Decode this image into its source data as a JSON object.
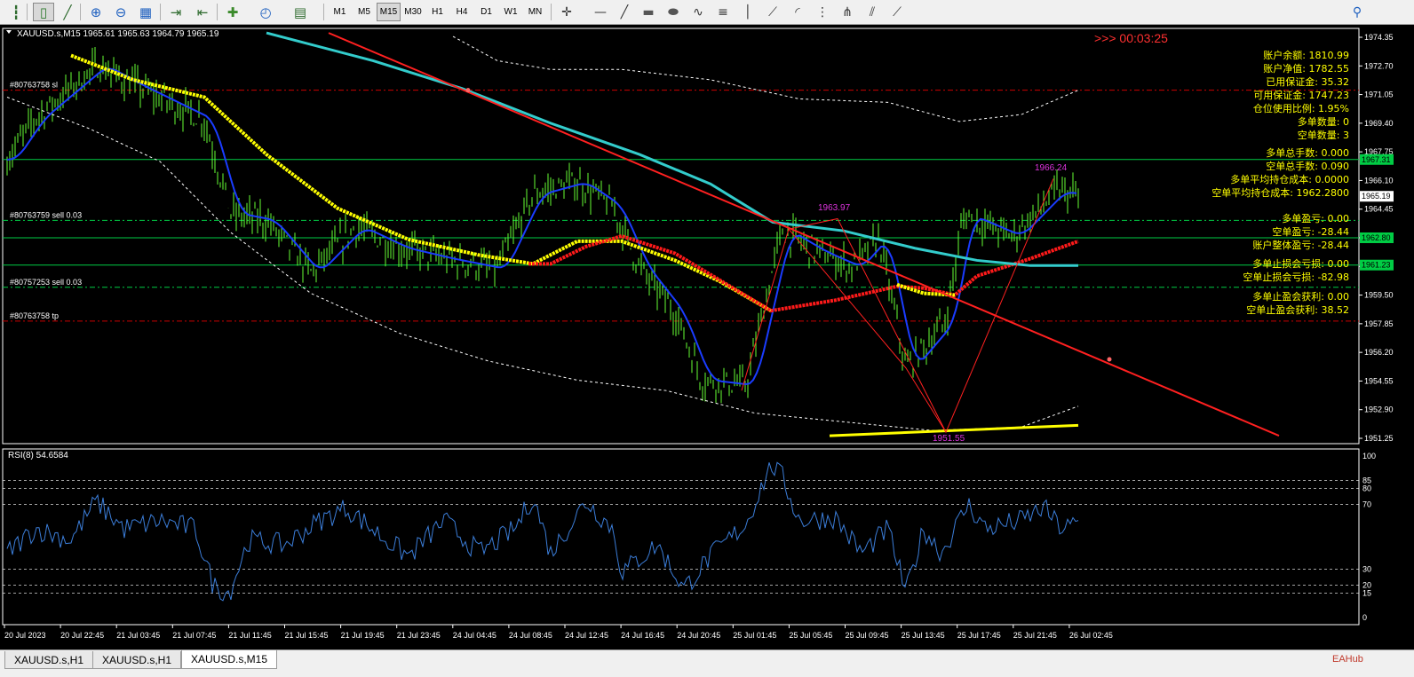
{
  "toolbar": {
    "buttons": [
      "bar-chart-icon",
      "candlestick-icon",
      "line-chart-icon",
      "zoom-in-icon",
      "zoom-out-icon",
      "tile-windows-icon",
      "auto-scroll-icon",
      "chart-shift-icon",
      "indicators-icon",
      "clock-icon",
      "templates-icon"
    ],
    "timeframes": [
      "M1",
      "M5",
      "M15",
      "M30",
      "H1",
      "H4",
      "D1",
      "W1",
      "MN"
    ],
    "active_timeframe": "M15",
    "draw_tools": [
      "crosshair-icon",
      "horizontal-line-icon",
      "trendline-icon",
      "rectangle-icon",
      "ellipse-icon",
      "elliott-icon",
      "fibonacci-icon",
      "vertical-line-icon",
      "fibo-fan-icon",
      "fibo-arc-icon",
      "fibo-time-icon",
      "andrews-icon",
      "channel-icon",
      "gann-icon",
      "search-icon"
    ]
  },
  "chart": {
    "header": "XAUUSD.s,M15  1965.61 1965.63 1964.79 1965.19",
    "timer": ">>> 00:03:25",
    "price_axis": [
      "1974.35",
      "1972.70",
      "1971.05",
      "1969.40",
      "1967.75",
      "1966.10",
      "1964.45",
      "1962.80",
      "1961.15",
      "1959.50",
      "1957.85",
      "1956.20",
      "1954.55",
      "1952.90",
      "1951.25"
    ],
    "price_tags": [
      {
        "label": "1967.31",
        "color": "#00cc44"
      },
      {
        "label": "1965.19",
        "color": "#ffffff"
      },
      {
        "label": "1962.80",
        "color": "#00cc44"
      },
      {
        "label": "1961.23",
        "color": "#00cc44"
      }
    ],
    "time_axis": [
      "20 Jul 2023",
      "20 Jul 22:45",
      "21 Jul 03:45",
      "21 Jul 07:45",
      "21 Jul 11:45",
      "21 Jul 15:45",
      "21 Jul 19:45",
      "21 Jul 23:45",
      "24 Jul 04:45",
      "24 Jul 08:45",
      "24 Jul 12:45",
      "24 Jul 16:45",
      "24 Jul 20:45",
      "25 Jul 01:45",
      "25 Jul 05:45",
      "25 Jul 09:45",
      "25 Jul 13:45",
      "25 Jul 17:45",
      "25 Jul 21:45",
      "26 Jul 02:45"
    ],
    "order_lines": [
      {
        "label": "#80763758 sl",
        "price": 1971.3,
        "color": "#cc0000"
      },
      {
        "label": "#80763759 sell 0.03",
        "price": 1963.8,
        "color": "#00cc44"
      },
      {
        "label": "#80757253 sell 0.03",
        "price": 1959.95,
        "color": "#00cc44"
      },
      {
        "label": "#80763758 tp",
        "price": 1958.0,
        "color": "#cc0000"
      }
    ],
    "swing_labels": [
      "1963.97",
      "1966.24",
      "1951.55"
    ],
    "account_panel": [
      "账户余额: 1810.99",
      "账户净值: 1782.55",
      "已用保证金: 35.32",
      "可用保证金: 1747.23",
      "仓位使用比例: 1.95%",
      "多单数量: 0",
      "空单数量: 3",
      "多单总手数: 0.000",
      "空单总手数: 0.090",
      "多单平均持仓成本: 0.0000",
      "空单平均持仓成本: 1962.2800",
      "多单盈亏: 0.00",
      "空单盈亏: -28.44",
      "账户整体盈亏: -28.44",
      "多单止损会亏损: 0.00",
      "空单止损会亏损: -82.98",
      "多单止盈会获利: 0.00",
      "空单止盈会获利: 38.52"
    ],
    "colors": {
      "candles": "#66ff33",
      "ma_yellow": "#ffff00",
      "ma_red": "#ff1a1a",
      "ma_cyan": "#33cccc",
      "ma_blue": "#1a3cff",
      "trend": "#ff2020",
      "bands": "#ffffff",
      "text": "#ffff00",
      "axis": "#ffffff"
    }
  },
  "rsi": {
    "header": "RSI(8) 54.6584",
    "axis": [
      "100",
      "85",
      "80",
      "70",
      "30",
      "20",
      "15",
      "0"
    ],
    "color": "#3b7dd8"
  },
  "tabs": [
    "XAUUSD.s,H1",
    "XAUUSD.s,H1",
    "XAUUSD.s,M15"
  ],
  "active_tab": 2,
  "watermark": "EAHub"
}
